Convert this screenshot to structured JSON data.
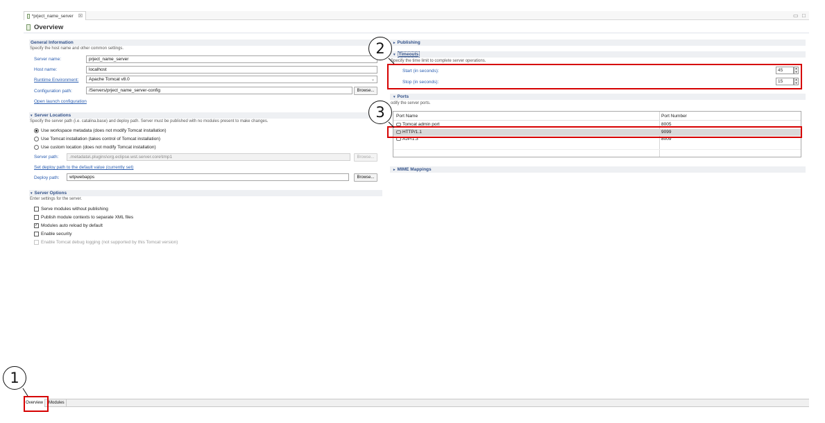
{
  "editor": {
    "tab_label": "*prject_name_server",
    "tab_close": "☒",
    "minimize": "▭",
    "maximize": "□",
    "page_title": "Overview"
  },
  "general": {
    "heading": "General Information",
    "description": "Specify the host name and other common settings.",
    "server_name_label": "Server name:",
    "server_name_value": "prject_name_server",
    "host_name_label": "Host name:",
    "host_name_value": "localhost",
    "runtime_label": "Runtime Environment:",
    "runtime_value": "Apache Tomcat v8.0",
    "config_path_label": "Configuration path:",
    "config_path_value": "/Servers/prject_name_server-config",
    "browse": "Browse...",
    "open_launch": "Open launch configuration"
  },
  "locations": {
    "heading": "Server Locations",
    "description": "Specify the server path (i.e. catalina.base) and deploy path. Server must be published with no modules present to make changes.",
    "option1": "Use workspace metadata (does not modify Tomcat installation)",
    "option2": "Use Tomcat installation (takes control of Tomcat installation)",
    "option3": "Use custom location (does not modify Tomcat installation)",
    "server_path_label": "Server path:",
    "server_path_value": ".metadata\\.plugins\\org.eclipse.wst.server.core\\tmp1",
    "browse": "Browse...",
    "set_default": "Set deploy path to the default value (currently set)",
    "deploy_path_label": "Deploy path:",
    "deploy_path_value": "wtpwebapps",
    "browse2": "Browse..."
  },
  "options": {
    "heading": "Server Options",
    "description": "Enter settings for the server.",
    "items": [
      {
        "label": "Serve modules without publishing",
        "checked": false,
        "enabled": true
      },
      {
        "label": "Publish module contexts to separate XML files",
        "checked": false,
        "enabled": true
      },
      {
        "label": "Modules auto reload by default",
        "checked": true,
        "enabled": true
      },
      {
        "label": "Enable security",
        "checked": false,
        "enabled": true
      },
      {
        "label": "Enable Tomcat debug logging (not supported by this Tomcat version)",
        "checked": false,
        "enabled": false
      }
    ]
  },
  "publishing": {
    "heading": "Publishing"
  },
  "timeouts": {
    "heading": "Timeouts",
    "description": "Specify the time limit to complete server operations.",
    "start_label": "Start (in seconds):",
    "start_value": "45",
    "stop_label": "Stop (in seconds):",
    "stop_value": "15"
  },
  "ports": {
    "heading": "Ports",
    "description": "odify the server ports.",
    "col_name": "Port Name",
    "col_number": "Port Number",
    "rows": [
      {
        "name": "Tomcat admin port",
        "number": "8005"
      },
      {
        "name": "HTTP/1.1",
        "number": "9099"
      },
      {
        "name": "AJP/1.3",
        "number": "8009"
      }
    ]
  },
  "mime": {
    "heading": "MIME Mappings"
  },
  "bottom_tabs": {
    "overview": "Overview",
    "modules": "Modules"
  },
  "callouts": {
    "one": "1",
    "two": "2",
    "three": "3"
  },
  "colors": {
    "highlight_red": "#d60000",
    "section_blue": "#33528a",
    "link_blue": "#2a5db0"
  }
}
